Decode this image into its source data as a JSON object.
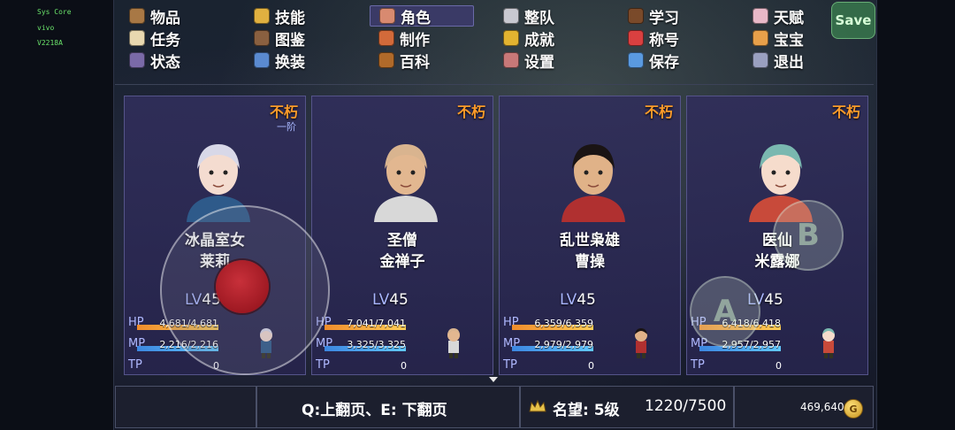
{
  "system": {
    "line1": "Sys Core",
    "line2": "vivo",
    "line3": "V2218A"
  },
  "menu": {
    "items": [
      {
        "label": "物品",
        "icon": "bag-icon",
        "color": "#a87845"
      },
      {
        "label": "技能",
        "icon": "skill-icon",
        "color": "#e0b040"
      },
      {
        "label": "角色",
        "icon": "mask-icon",
        "color": "#d88a70",
        "selected": true
      },
      {
        "label": "整队",
        "icon": "formation-icon",
        "color": "#c8c8d0"
      },
      {
        "label": "学习",
        "icon": "book-icon",
        "color": "#7a4a2a"
      },
      {
        "label": "天赋",
        "icon": "talent-icon",
        "color": "#e8b8c8"
      },
      {
        "label": "任务",
        "icon": "quest-icon",
        "color": "#e8d8b0"
      },
      {
        "label": "图鉴",
        "icon": "album-icon",
        "color": "#8a6040"
      },
      {
        "label": "制作",
        "icon": "craft-icon",
        "color": "#d26a3a"
      },
      {
        "label": "成就",
        "icon": "trophy-icon",
        "color": "#e3b330"
      },
      {
        "label": "称号",
        "icon": "medal-icon",
        "color": "#d94040"
      },
      {
        "label": "宝宝",
        "icon": "pet-icon",
        "color": "#e8a04a"
      },
      {
        "label": "状态",
        "icon": "status-icon",
        "color": "#7a6aa8"
      },
      {
        "label": "换装",
        "icon": "outfit-icon",
        "color": "#5a8ad0"
      },
      {
        "label": "百科",
        "icon": "encyclopedia-icon",
        "color": "#b06a2a"
      },
      {
        "label": "设置",
        "icon": "gear-icon",
        "color": "#c87878"
      },
      {
        "label": "保存",
        "icon": "floppy-icon",
        "color": "#5a9ae0"
      },
      {
        "label": "退出",
        "icon": "exit-icon",
        "color": "#9aa0c0"
      }
    ],
    "save_button": "Save"
  },
  "party": [
    {
      "status": "不朽",
      "rank": "一阶",
      "title": "冰晶室女",
      "name": "莱莉",
      "lv_label": "LV",
      "level": "45",
      "hp": "4,681/4,681",
      "mp": "2,216/2,216",
      "tp": "0",
      "hp_fill": 1.0,
      "mp_fill": 1.0,
      "hair": "#d8d8e8",
      "skin": "#f4dcd0",
      "cloth": "#2e5a8a"
    },
    {
      "status": "不朽",
      "title": "圣僧",
      "name": "金禅子",
      "lv_label": "LV",
      "level": "45",
      "hp": "7,041/7,041",
      "mp": "3,325/3,325",
      "tp": "0",
      "hp_fill": 1.0,
      "mp_fill": 1.0,
      "hair": "#d9b48f",
      "skin": "#e2b790",
      "cloth": "#d8d8d8"
    },
    {
      "status": "不朽",
      "title": "乱世枭雄",
      "name": "曹操",
      "lv_label": "LV",
      "level": "45",
      "hp": "6,359/6,359",
      "mp": "2,979/2,979",
      "tp": "0",
      "hp_fill": 1.0,
      "mp_fill": 1.0,
      "hair": "#1a1414",
      "skin": "#e0b288",
      "cloth": "#b03030"
    },
    {
      "status": "不朽",
      "title": "医仙",
      "name": "米露娜",
      "lv_label": "LV",
      "level": "45",
      "hp": "6,418/6,418",
      "mp": "2,957/2,957",
      "tp": "0",
      "hp_fill": 1.0,
      "mp_fill": 1.0,
      "hair": "#7ab8b0",
      "skin": "#f6dccc",
      "cloth": "#c84a3a"
    }
  ],
  "stats": {
    "hp": "HP",
    "mp": "MP",
    "tp": "TP"
  },
  "controls": {
    "b_button": "B",
    "a_button": "A"
  },
  "footer": {
    "page_hint": "Q:上翻页、E: 下翻页",
    "fame_label": "名望: 5级",
    "fame_progress": "1220/7500",
    "gold": "469,640",
    "coin_glyph": "G"
  }
}
